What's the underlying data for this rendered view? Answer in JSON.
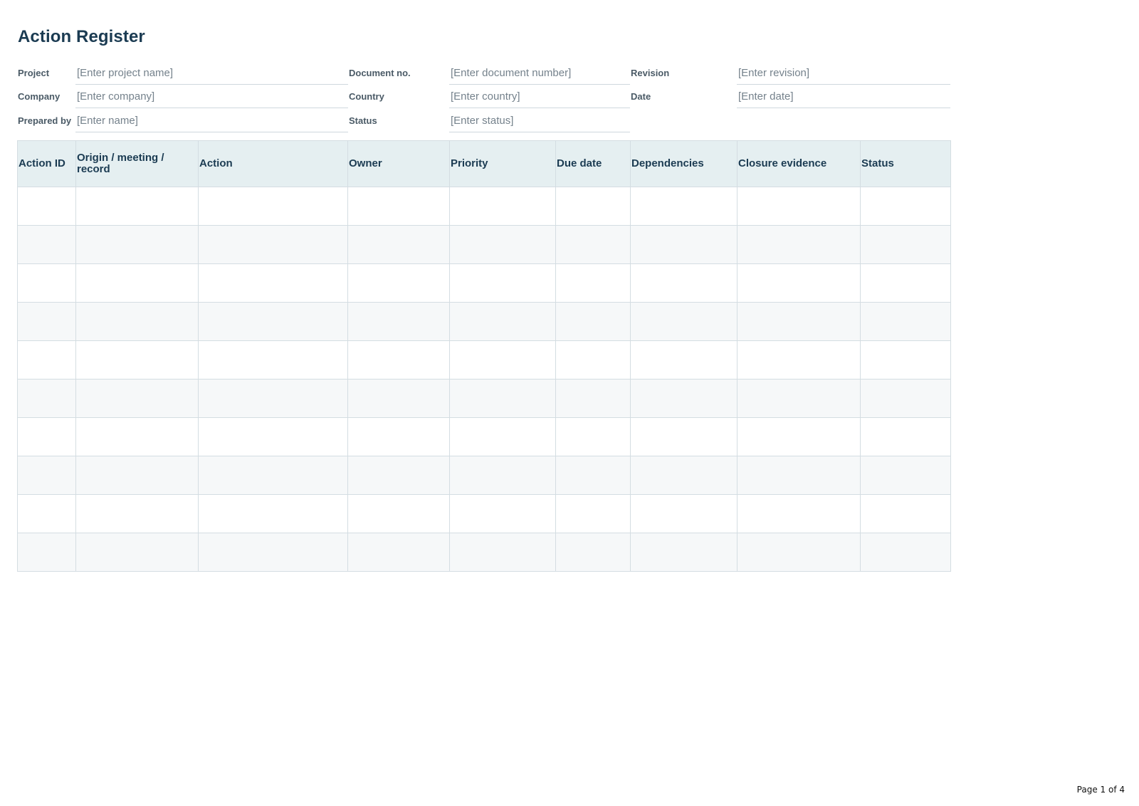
{
  "title": "Action Register",
  "meta": {
    "project": {
      "label": "Project",
      "value": "[Enter project name]"
    },
    "document_no": {
      "label": "Document no.",
      "value": "[Enter document number]"
    },
    "revision": {
      "label": "Revision",
      "value": "[Enter revision]"
    },
    "company": {
      "label": "Company",
      "value": "[Enter company]"
    },
    "country": {
      "label": "Country",
      "value": "[Enter country]"
    },
    "date": {
      "label": "Date",
      "value": "[Enter date]"
    },
    "prepared_by": {
      "label": "Prepared by",
      "value": "[Enter name]"
    },
    "status": {
      "label": "Status",
      "value": "[Enter status]"
    }
  },
  "table": {
    "columns": [
      "Action ID",
      "Origin / meeting / record",
      "Action",
      "Owner",
      "Priority",
      "Due date",
      "Dependencies",
      "Closure evidence",
      "Status"
    ],
    "rows": [
      [
        "",
        "",
        "",
        "",
        "",
        "",
        "",
        "",
        ""
      ],
      [
        "",
        "",
        "",
        "",
        "",
        "",
        "",
        "",
        ""
      ],
      [
        "",
        "",
        "",
        "",
        "",
        "",
        "",
        "",
        ""
      ],
      [
        "",
        "",
        "",
        "",
        "",
        "",
        "",
        "",
        ""
      ],
      [
        "",
        "",
        "",
        "",
        "",
        "",
        "",
        "",
        ""
      ],
      [
        "",
        "",
        "",
        "",
        "",
        "",
        "",
        "",
        ""
      ],
      [
        "",
        "",
        "",
        "",
        "",
        "",
        "",
        "",
        ""
      ],
      [
        "",
        "",
        "",
        "",
        "",
        "",
        "",
        "",
        ""
      ],
      [
        "",
        "",
        "",
        "",
        "",
        "",
        "",
        "",
        ""
      ],
      [
        "",
        "",
        "",
        "",
        "",
        "",
        "",
        "",
        ""
      ]
    ]
  },
  "footer": {
    "page": "Page 1 of 4"
  }
}
